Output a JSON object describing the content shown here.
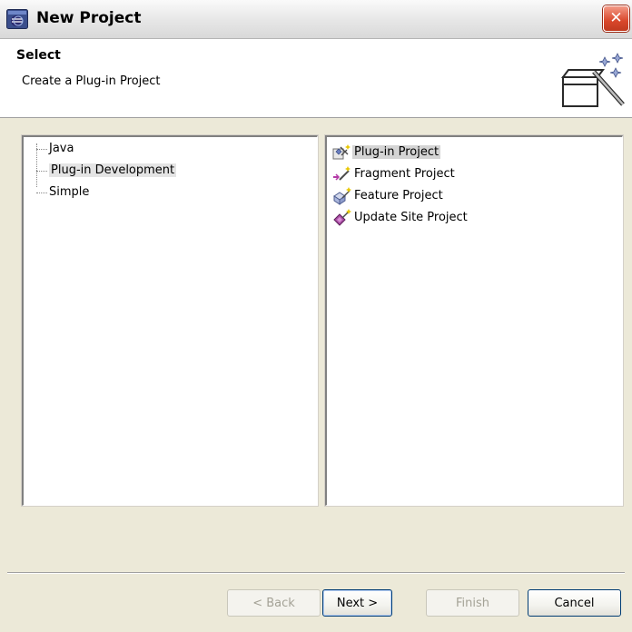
{
  "window": {
    "title": "New Project",
    "close_glyph": "✕"
  },
  "banner": {
    "title": "Select",
    "description": "Create a Plug-in Project"
  },
  "tree": {
    "items": [
      {
        "label": "Java",
        "selected": false
      },
      {
        "label": "Plug-in Development",
        "selected": true
      },
      {
        "label": "Simple",
        "selected": false
      }
    ]
  },
  "wizards": {
    "items": [
      {
        "label": "Plug-in Project",
        "icon": "plugin-project-icon",
        "selected": true
      },
      {
        "label": "Fragment Project",
        "icon": "fragment-project-icon",
        "selected": false
      },
      {
        "label": "Feature Project",
        "icon": "feature-project-icon",
        "selected": false
      },
      {
        "label": "Update Site Project",
        "icon": "update-site-project-icon",
        "selected": false
      }
    ]
  },
  "buttons": {
    "back": "< Back",
    "next": "Next >",
    "finish": "Finish",
    "cancel": "Cancel"
  },
  "colors": {
    "dialog_bg": "#ECE9D8",
    "close_button": "#D9472B",
    "selection": "#D4D4D4"
  }
}
